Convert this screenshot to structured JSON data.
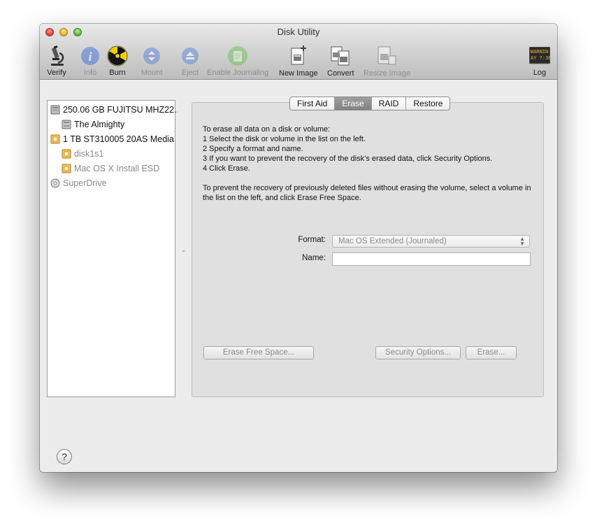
{
  "window": {
    "title": "Disk Utility"
  },
  "toolbar": {
    "verify": "Verify",
    "info": "Info",
    "burn": "Burn",
    "mount": "Mount",
    "eject": "Eject",
    "enable_journaling": "Enable Journaling",
    "new_image": "New Image",
    "convert": "Convert",
    "resize_image": "Resize Image",
    "log": "Log",
    "log_icon_text": "WARNIN AY 7:36"
  },
  "sidebar": {
    "items": [
      {
        "label": "250.06 GB FUJITSU MHZ22...",
        "icon": "internal-disk-icon"
      },
      {
        "label": "The Almighty",
        "icon": "volume-icon"
      },
      {
        "label": "1 TB ST310005 20AS Media",
        "icon": "external-disk-icon"
      },
      {
        "label": "disk1s1",
        "icon": "external-volume-icon"
      },
      {
        "label": "Mac OS X Install ESD",
        "icon": "external-volume-icon"
      },
      {
        "label": "SuperDrive",
        "icon": "optical-drive-icon"
      }
    ]
  },
  "tabs": [
    "First Aid",
    "Erase",
    "RAID",
    "Restore"
  ],
  "active_tab": "Erase",
  "erase": {
    "intro": "To erase all data on a disk or volume:",
    "steps": [
      "1 Select the disk or volume in the list on the left.",
      "2 Specify a format and name.",
      "3 If you want to prevent the recovery of the disk’s erased data, click Security Options.",
      "4 Click Erase."
    ],
    "free_space_note": "To prevent the recovery of previously deleted files without erasing the volume, select a volume in the list on the left, and click Erase Free Space.",
    "format_label": "Format:",
    "format_value": "Mac OS Extended (Journaled)",
    "name_label": "Name:",
    "name_value": "",
    "erase_free_space_button": "Erase Free Space...",
    "security_options_button": "Security Options...",
    "erase_button": "Erase..."
  },
  "help_button": "?",
  "colors": {
    "window_bg": "#ececec",
    "active_tab_bg": "#8f8f8f",
    "disabled_text": "#8a8a8a"
  }
}
